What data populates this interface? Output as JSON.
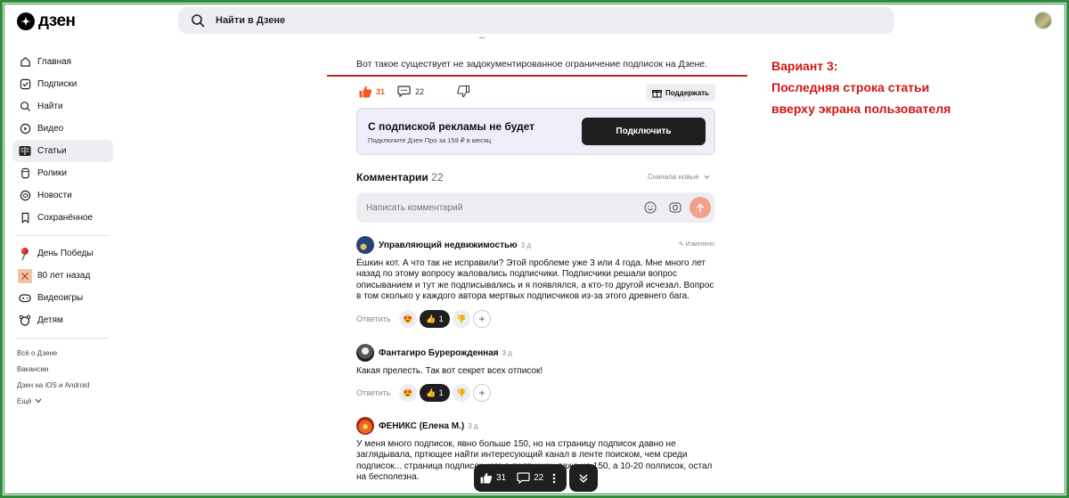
{
  "app": {
    "brand": "дзен"
  },
  "search": {
    "placeholder": "Найти в Дзене"
  },
  "sidebar": {
    "items": [
      {
        "label": "Главная",
        "icon": "home-icon"
      },
      {
        "label": "Подписки",
        "icon": "subscriptions-icon"
      },
      {
        "label": "Найти",
        "icon": "search-icon"
      },
      {
        "label": "Видео",
        "icon": "video-icon"
      },
      {
        "label": "Статьи",
        "icon": "articles-icon",
        "active": true
      },
      {
        "label": "Ролики",
        "icon": "shorts-icon"
      },
      {
        "label": "Новости",
        "icon": "news-icon"
      },
      {
        "label": "Сохранённое",
        "icon": "bookmark-icon"
      }
    ],
    "special": [
      {
        "label": "День Победы",
        "icon": "carnation-icon"
      },
      {
        "label": "80 лет назад",
        "icon": "stamp-icon"
      },
      {
        "label": "Видеоигры",
        "icon": "gamepad-icon"
      },
      {
        "label": "Детям",
        "icon": "kids-icon"
      }
    ],
    "footer": [
      "Всё о Дзене",
      "Вакансии",
      "Дзен на iOS и Android",
      "Ещё"
    ]
  },
  "article": {
    "last_line": "Вот такое существует не задокументированное ограничение подписок на Дзене.",
    "likes": "31",
    "comments": "22",
    "support_label": "Поддержать"
  },
  "promo": {
    "title": "С подпиской рекламы не будет",
    "subtitle": "Подключите Дзен Про за 159 ₽ в месяц",
    "button": "Подключить"
  },
  "comments": {
    "title": "Комментарии",
    "count": "22",
    "sort": "Сначала новые",
    "input_placeholder": "Написать комментарий",
    "reply_label": "Ответить",
    "items": [
      {
        "author": "Управляющий недвижимостью",
        "time": "3 д",
        "edited": "Изменено",
        "text": "Ёшкин кот. А что так не исправили? Этой проблеме уже 3 или 4 года. Мне много лет назад по этому вопросу жаловались подписчики. Подписчики решали вопрос описыванием и тут же подписывались и я появлялся, а кто-то другой исчезал. Вопрос в том сколько у каждого автора мертвых подписчиков из-за этого древнего бага.",
        "reaction_count": "1"
      },
      {
        "author": "Фантагиро Бурерожденная",
        "time": "3 д",
        "text": "Какая прелесть. Так вот секрет всех отписок!",
        "reaction_count": "1"
      },
      {
        "author": "ФЕНИКС (Елена М.)",
        "time": "3 д",
        "text": "У меня много подписок, явно больше 150, но на страницу подписок давно не заглядывала, пртющее найти интересующий канал в ленте поиском, чем среди подписок... страница подписок кого в подписках даже не 150, а 10-20 полписок, остал на бесполезна."
      }
    ]
  },
  "annotation": {
    "line1": "Вариант 3:",
    "line2": "Последняя строка статьи",
    "line3": "вверху экрана пользователя"
  },
  "floating_bar": {
    "likes": "31",
    "comments": "22"
  },
  "colors": {
    "accent": "#f15a24",
    "annotation": "#d01616",
    "frame": "#2e8b3a"
  }
}
